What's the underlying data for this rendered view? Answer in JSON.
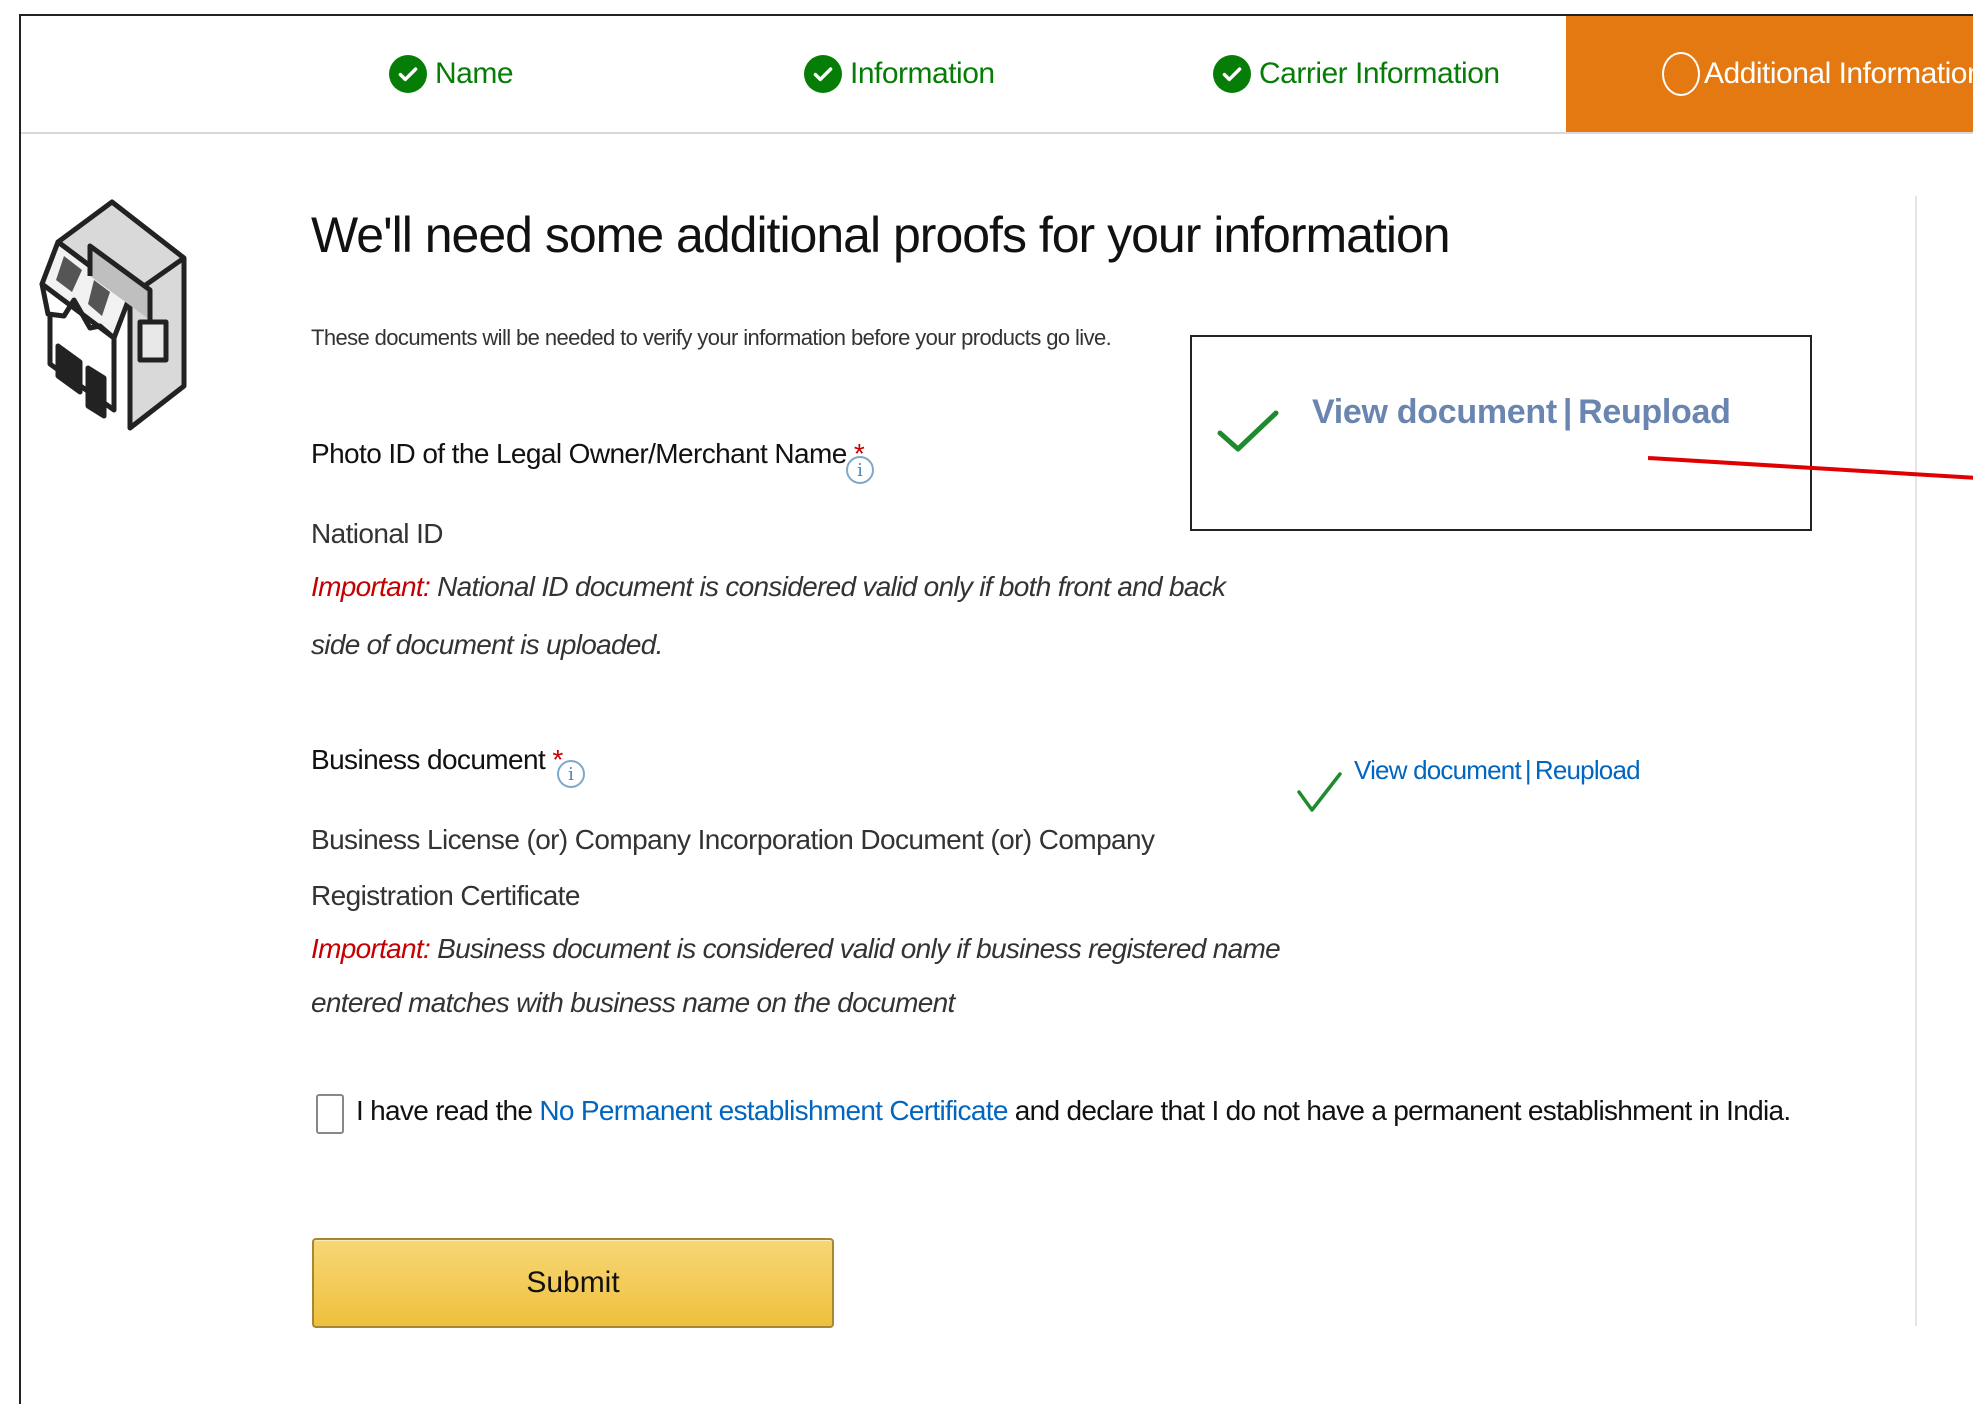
{
  "stepper": {
    "steps": [
      {
        "label": "Name",
        "status": "complete"
      },
      {
        "label": "Information",
        "status": "complete"
      },
      {
        "label": "Carrier Information",
        "status": "complete"
      },
      {
        "label": "Additional Information",
        "status": "active"
      }
    ]
  },
  "colors": {
    "accent": "#e47911",
    "success": "#067d06",
    "link": "#0066c0",
    "important": "#c40000",
    "button": "#f0c14b"
  },
  "main": {
    "title": "We'll need some additional proofs for your information",
    "subtitle": "These documents will be needed to verify your information before your products go live.",
    "photo_id": {
      "label": "Photo ID of the Legal Owner/Merchant Name",
      "required_mark": "*",
      "doc_type": "National ID",
      "important_prefix": "Important:",
      "important_line1": " National ID document is considered valid only if both front and back",
      "important_line2": "side of document is uploaded.",
      "view_link": "View document",
      "separator": "|",
      "reupload_link": "Reupload"
    },
    "business_doc": {
      "label": "Business document",
      "required_mark": "*",
      "doc_type_line1": "Business License (or) Company Incorporation Document (or) Company",
      "doc_type_line2": "Registration Certificate",
      "important_prefix": "Important:",
      "important_line1": " Business document is considered valid only if business registered name",
      "important_line2": "entered matches with business name on the document",
      "view_link": "View document",
      "separator": "|",
      "reupload_link": "Reupload"
    },
    "declaration": {
      "prefix": "I have read the ",
      "link": "No Permanent establishment Certificate",
      "suffix": " and declare that I do not have a permanent establishment in India."
    },
    "submit_label": "Submit"
  }
}
